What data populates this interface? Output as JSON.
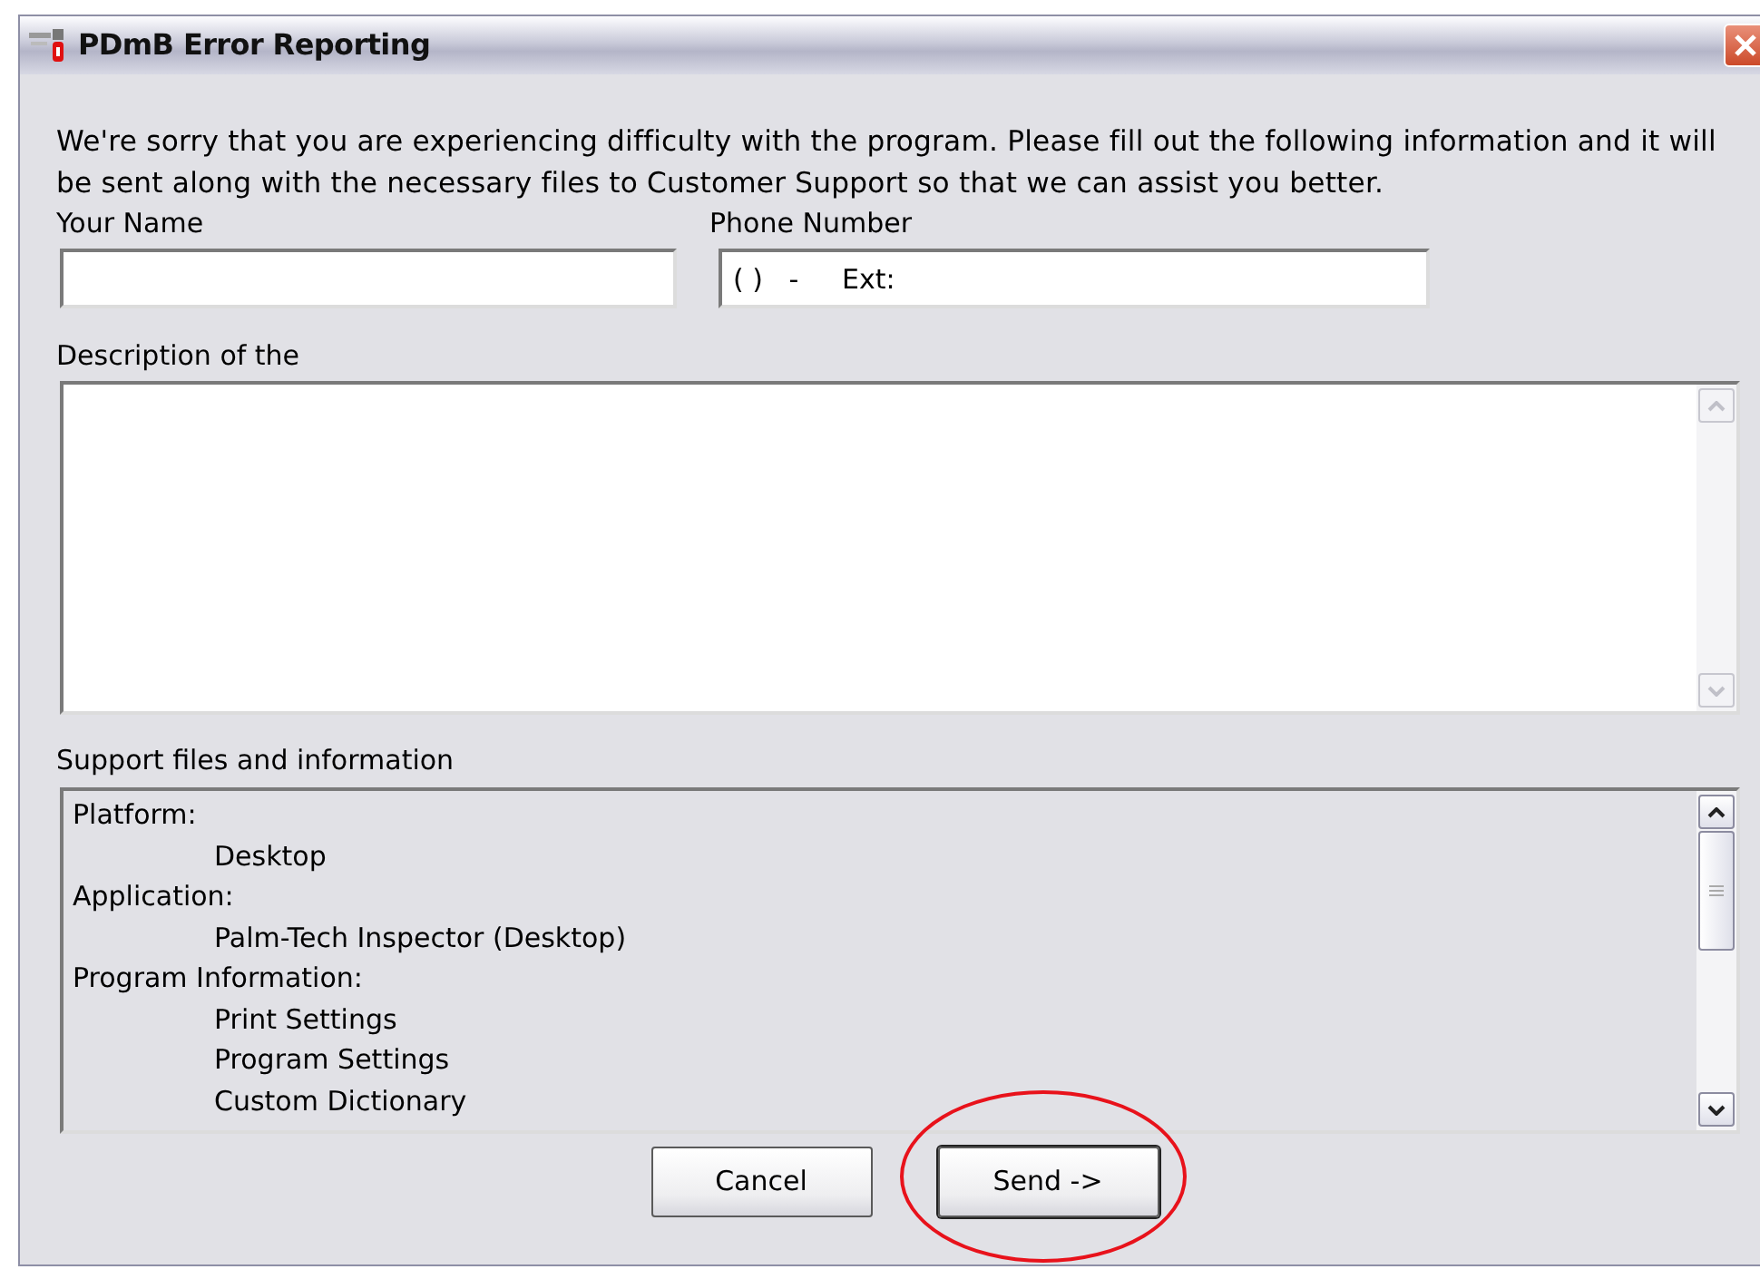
{
  "window": {
    "title": "PDmB Error Reporting"
  },
  "intro": "We're sorry that you are experiencing difficulty with the program. Please fill out the following information and it will be sent along with the necessary files to Customer Support so that we can assist you better.",
  "fields": [
    {
      "label": "Your Name"
    },
    {
      "label": "Phone Number",
      "value": "( )   -     Ext:"
    }
  ],
  "description": {
    "label": "Description of the"
  },
  "support": {
    "label": "Support files and information",
    "items": [
      {
        "text": "Platform:",
        "children": [
          {
            "text": "Desktop"
          }
        ]
      },
      {
        "text": "Application:",
        "children": [
          {
            "text": "Palm-Tech Inspector (Desktop)"
          }
        ]
      },
      {
        "text": "Program Information:",
        "children": [
          {
            "text": "Print Settings"
          },
          {
            "text": "Program Settings"
          },
          {
            "text": "Custom Dictionary"
          }
        ]
      }
    ]
  },
  "buttons": [
    {
      "label": "Cancel",
      "default": false,
      "circled": false
    },
    {
      "label": "Send ->",
      "default": true,
      "circled": true
    }
  ]
}
